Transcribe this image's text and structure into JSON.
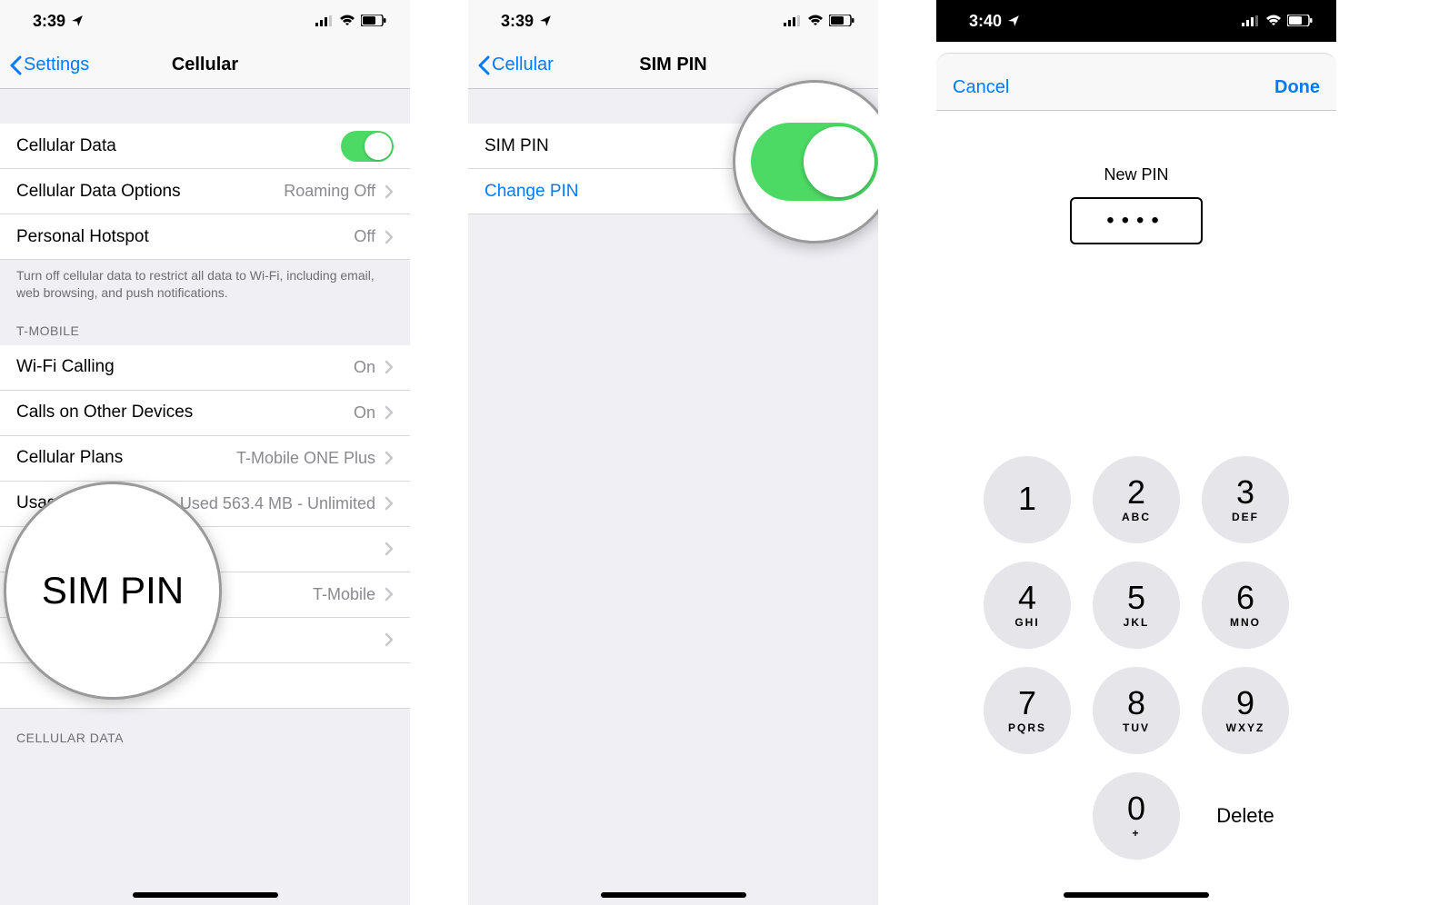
{
  "statusIcons": {
    "signal": "signal-icon",
    "wifi": "wifi-icon",
    "battery": "battery-icon",
    "location": "location-icon"
  },
  "screen1": {
    "time": "3:39",
    "back": "Settings",
    "title": "Cellular",
    "rows": {
      "cellularData": "Cellular Data",
      "cellularDataOptions": "Cellular Data Options",
      "cellularDataOptionsValue": "Roaming Off",
      "personalHotspot": "Personal Hotspot",
      "personalHotspotValue": "Off"
    },
    "footer": "Turn off cellular data to restrict all data to Wi-Fi, including email, web browsing, and push notifications.",
    "carrierHeader": "T-MOBILE",
    "carrierRows": {
      "wifiCalling": "Wi-Fi Calling",
      "wifiCallingValue": "On",
      "callsOther": "Calls on Other Devices",
      "callsOtherValue": "On",
      "plans": "Cellular Plans",
      "plansValue": "T-Mobile ONE Plus",
      "usage": "Usage",
      "usageValue": "Used 563.4 MB - Unlimited",
      "networkValue": "T-Mobile"
    },
    "bubble": "SIM PIN",
    "dataHeader": "CELLULAR DATA"
  },
  "screen2": {
    "time": "3:39",
    "back": "Cellular",
    "title": "SIM PIN",
    "rowSimPin": "SIM PIN",
    "rowChangePin": "Change PIN"
  },
  "screen3": {
    "time": "3:40",
    "cancel": "Cancel",
    "done": "Done",
    "newPinLabel": "New PIN",
    "pinValue": "••••",
    "keypad": [
      {
        "num": "1",
        "sub": ""
      },
      {
        "num": "2",
        "sub": "ABC"
      },
      {
        "num": "3",
        "sub": "DEF"
      },
      {
        "num": "4",
        "sub": "GHI"
      },
      {
        "num": "5",
        "sub": "JKL"
      },
      {
        "num": "6",
        "sub": "MNO"
      },
      {
        "num": "7",
        "sub": "PQRS"
      },
      {
        "num": "8",
        "sub": "TUV"
      },
      {
        "num": "9",
        "sub": "WXYZ"
      },
      {
        "num": "0",
        "sub": "+"
      }
    ],
    "delete": "Delete"
  }
}
